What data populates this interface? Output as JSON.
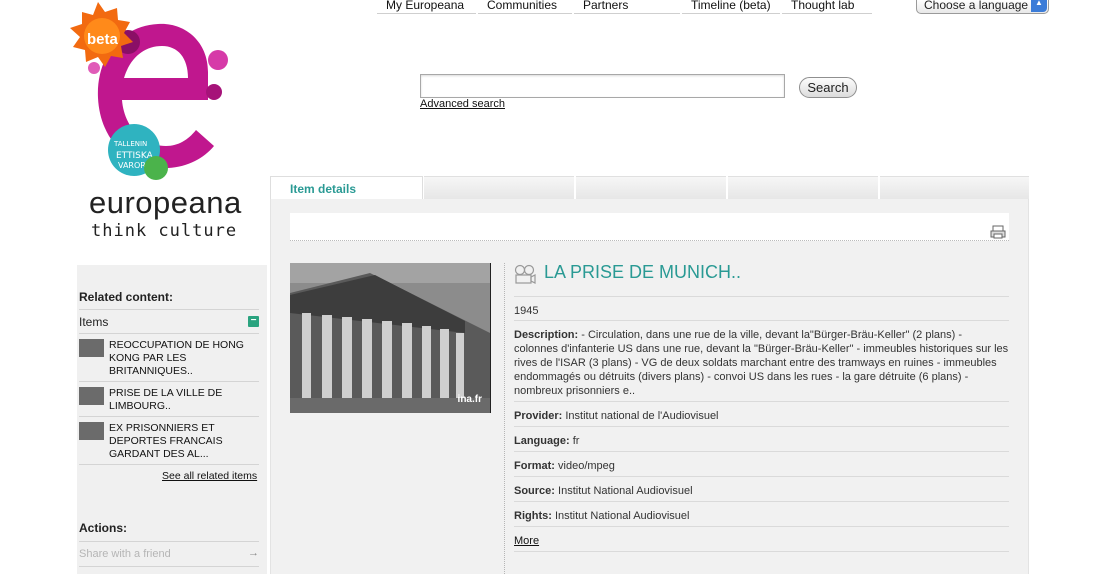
{
  "nav": {
    "items": [
      "My Europeana",
      "Communities",
      "Partners",
      "Timeline (beta)",
      "Thought lab"
    ],
    "language_select": "Choose a language"
  },
  "brand": {
    "badge": "beta",
    "name": "europeana",
    "tagline": "think culture",
    "colors": {
      "magenta": "#c0178e",
      "teal": "#2a9a94",
      "badge_orange": "#f26a10"
    }
  },
  "search": {
    "value": "",
    "button": "Search",
    "advanced": "Advanced search"
  },
  "tabs": {
    "active": "Item details"
  },
  "item": {
    "title": "LA PRISE DE MUNICH..",
    "type_icon": "video-camera-icon",
    "thumb_credit": "ina.fr",
    "year": "1945",
    "description_label": "Description:",
    "description": "- Circulation, dans une rue de la ville, devant la\"Bürger-Bräu-Keller\" (2 plans) - colonnes d'infanterie US dans une rue, devant la \"Bürger-Bräu-Keller\" - immeubles historiques sur les rives de l'ISAR (3 plans) - VG de deux soldats marchant entre des tramways en ruines - immeubles endommagés ou détruits (divers plans) - convoi US dans les rues - la gare détruite (6 plans) - nombreux prisonniers e..",
    "fields": [
      {
        "label": "Provider:",
        "value": "Institut national de l'Audiovisuel"
      },
      {
        "label": "Language:",
        "value": "fr"
      },
      {
        "label": "Format:",
        "value": "video/mpeg"
      },
      {
        "label": "Source:",
        "value": "Institut National Audiovisuel"
      },
      {
        "label": "Rights:",
        "value": "Institut National Audiovisuel"
      }
    ],
    "more": "More"
  },
  "sidebar": {
    "related_heading": "Related content:",
    "items_label": "Items",
    "related_items": [
      {
        "title": "REOCCUPATION DE HONG KONG PAR LES BRITANNIQUES.."
      },
      {
        "title": "PRISE DE LA VILLE DE LIMBOURG.."
      },
      {
        "title": "EX PRISONNIERS ET DEPORTES FRANCAIS GARDANT DES AL..."
      }
    ],
    "see_all": "See all related items",
    "actions_heading": "Actions:",
    "share": "Share with a friend"
  }
}
